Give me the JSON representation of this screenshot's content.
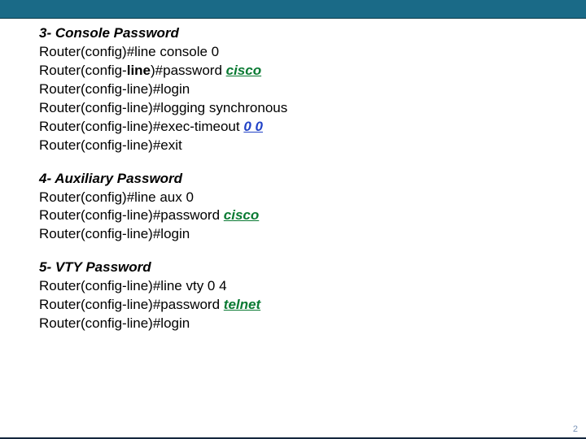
{
  "page_number": "2",
  "sections": {
    "console": {
      "title": "3- Console Password",
      "l1_prefix": "Router(config)#",
      "l1_cmd": "line console 0",
      "l2_prefix": "Router(config-",
      "l2_bold": "line",
      "l2_suffix": ")#",
      "l2_cmd": "password ",
      "l2_value": "cisco",
      "l3": "Router(config-line)#login",
      "l4": "Router(config-line)#logging synchronous",
      "l5_prefix": "Router(config-line)#exec-timeout ",
      "l5_value": "0 0",
      "l6": "Router(config-line)#exit"
    },
    "aux": {
      "title": "4- Auxiliary Password",
      "l1": "Router(config)#line aux 0",
      "l2_prefix": "Router(config-line)#password ",
      "l2_value": "cisco",
      "l3": "Router(config-line)#login"
    },
    "vty": {
      "title": "5- VTY Password",
      "l1": "Router(config-line)#line vty 0 4",
      "l2_prefix": "Router(config-line)#password ",
      "l2_value": "telnet",
      "l3": "Router(config-line)#login"
    }
  }
}
